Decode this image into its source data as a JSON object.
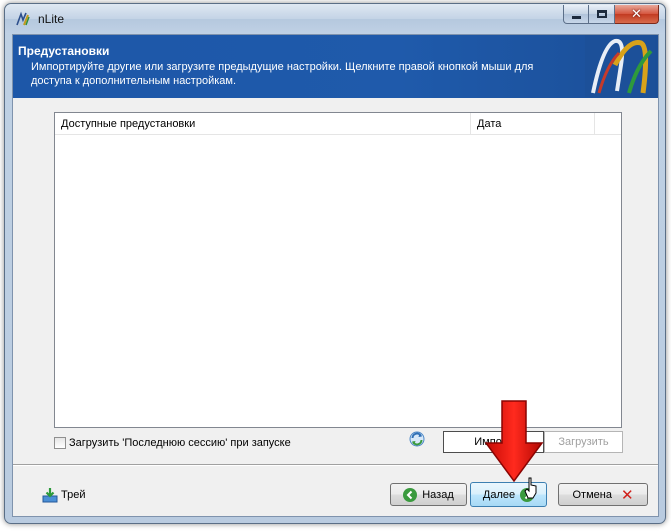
{
  "window": {
    "title": "nLite",
    "close_color": "#c23a21"
  },
  "header": {
    "title": "Предустановки",
    "description": "Импортируйте другие или загрузите предыдущие настройки. Щелкните правой кнопкой мыши для доступа к дополнительным настройкам.",
    "background_color": "#1f5aab",
    "logo_icon": "nlite-logo"
  },
  "presets_list": {
    "columns": [
      "Доступные предустановки",
      "Дата"
    ],
    "rows": []
  },
  "load_last_session": {
    "label": "Загрузить 'Последнюю сессию' при запуске",
    "checked": false
  },
  "buttons": {
    "import": "Импорт",
    "load": "Загрузить",
    "back": "Назад",
    "next": "Далее",
    "cancel": "Отмена"
  },
  "tray": {
    "label": "Трей",
    "icon": "tray-icon"
  },
  "annotation": {
    "arrow_color": "#e8120c",
    "arrow_target": "next-button"
  }
}
